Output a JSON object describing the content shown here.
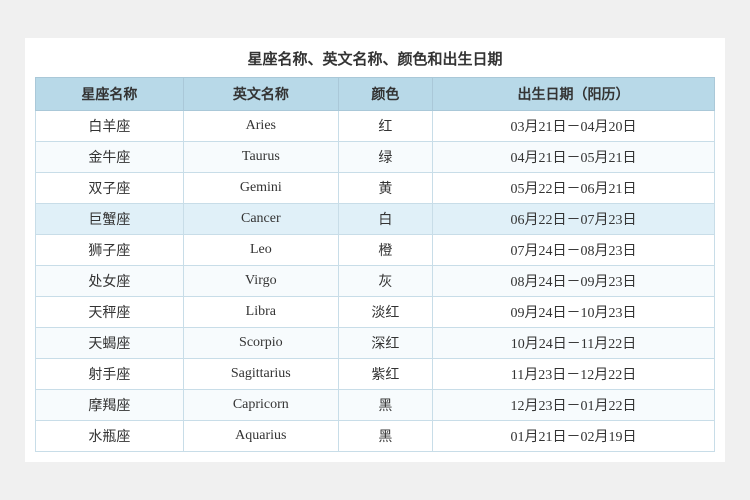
{
  "title": "星座名称、英文名称、颜色和出生日期",
  "headers": [
    "星座名称",
    "英文名称",
    "颜色",
    "出生日期（阳历）"
  ],
  "rows": [
    {
      "zh": "白羊座",
      "en": "Aries",
      "color": "红",
      "date": "03月21日－04月20日"
    },
    {
      "zh": "金牛座",
      "en": "Taurus",
      "color": "绿",
      "date": "04月21日－05月21日"
    },
    {
      "zh": "双子座",
      "en": "Gemini",
      "color": "黄",
      "date": "05月22日－06月21日"
    },
    {
      "zh": "巨蟹座",
      "en": "Cancer",
      "color": "白",
      "date": "06月22日－07月23日"
    },
    {
      "zh": "狮子座",
      "en": "Leo",
      "color": "橙",
      "date": "07月24日－08月23日"
    },
    {
      "zh": "处女座",
      "en": "Virgo",
      "color": "灰",
      "date": "08月24日－09月23日"
    },
    {
      "zh": "天秤座",
      "en": "Libra",
      "color": "淡红",
      "date": "09月24日－10月23日"
    },
    {
      "zh": "天蝎座",
      "en": "Scorpio",
      "color": "深红",
      "date": "10月24日－11月22日"
    },
    {
      "zh": "射手座",
      "en": "Sagittarius",
      "color": "紫红",
      "date": "11月23日－12月22日"
    },
    {
      "zh": "摩羯座",
      "en": "Capricorn",
      "color": "黑",
      "date": "12月23日－01月22日"
    },
    {
      "zh": "水瓶座",
      "en": "Aquarius",
      "color": "黑",
      "date": "01月21日－02月19日"
    }
  ]
}
